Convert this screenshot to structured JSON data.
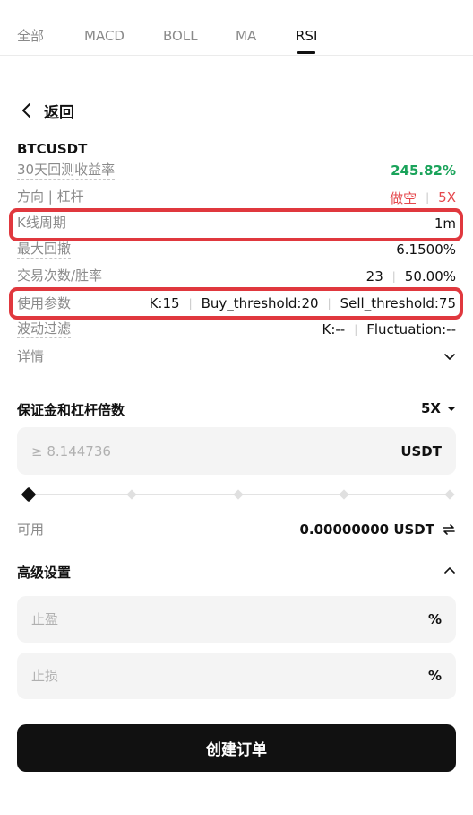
{
  "tabs": [
    {
      "label": "全部"
    },
    {
      "label": "MACD"
    },
    {
      "label": "BOLL"
    },
    {
      "label": "MA"
    },
    {
      "label": "RSI"
    }
  ],
  "back": {
    "label": "返回"
  },
  "symbol": "BTCUSDT",
  "rows": {
    "return_30d": {
      "label": "30天回测收益率",
      "value": "245.82%"
    },
    "direction": {
      "label": "方向 | 杠杆",
      "side": "做空",
      "leverage": "5X"
    },
    "kline": {
      "label": "K线周期",
      "value": "1m"
    },
    "drawdown": {
      "label": "最大回撤",
      "value": "6.1500%"
    },
    "trades": {
      "label": "交易次数/胜率",
      "count": "23",
      "winrate": "50.00%"
    },
    "params": {
      "label": "使用参数",
      "k": "K:15",
      "buy": "Buy_threshold:20",
      "sell": "Sell_threshold:75"
    },
    "filter": {
      "label": "波动过滤",
      "k": "K:--",
      "fluct": "Fluctuation:--"
    },
    "details": {
      "label": "详情"
    }
  },
  "margin": {
    "title": "保证金和杠杆倍数",
    "leverage": "5X",
    "placeholder": "≥ 8.144736",
    "unit": "USDT",
    "slider_percent": 0
  },
  "available": {
    "label": "可用",
    "value": "0.00000000 USDT"
  },
  "advanced": {
    "title": "高级设置",
    "take_profit": {
      "placeholder": "止盈",
      "unit": "%"
    },
    "stop_loss": {
      "placeholder": "止损",
      "unit": "%"
    }
  },
  "submit_label": "创建订单",
  "colors": {
    "accent_green": "#1aa35a",
    "accent_red": "#e5484d",
    "highlight": "#e0383e"
  }
}
